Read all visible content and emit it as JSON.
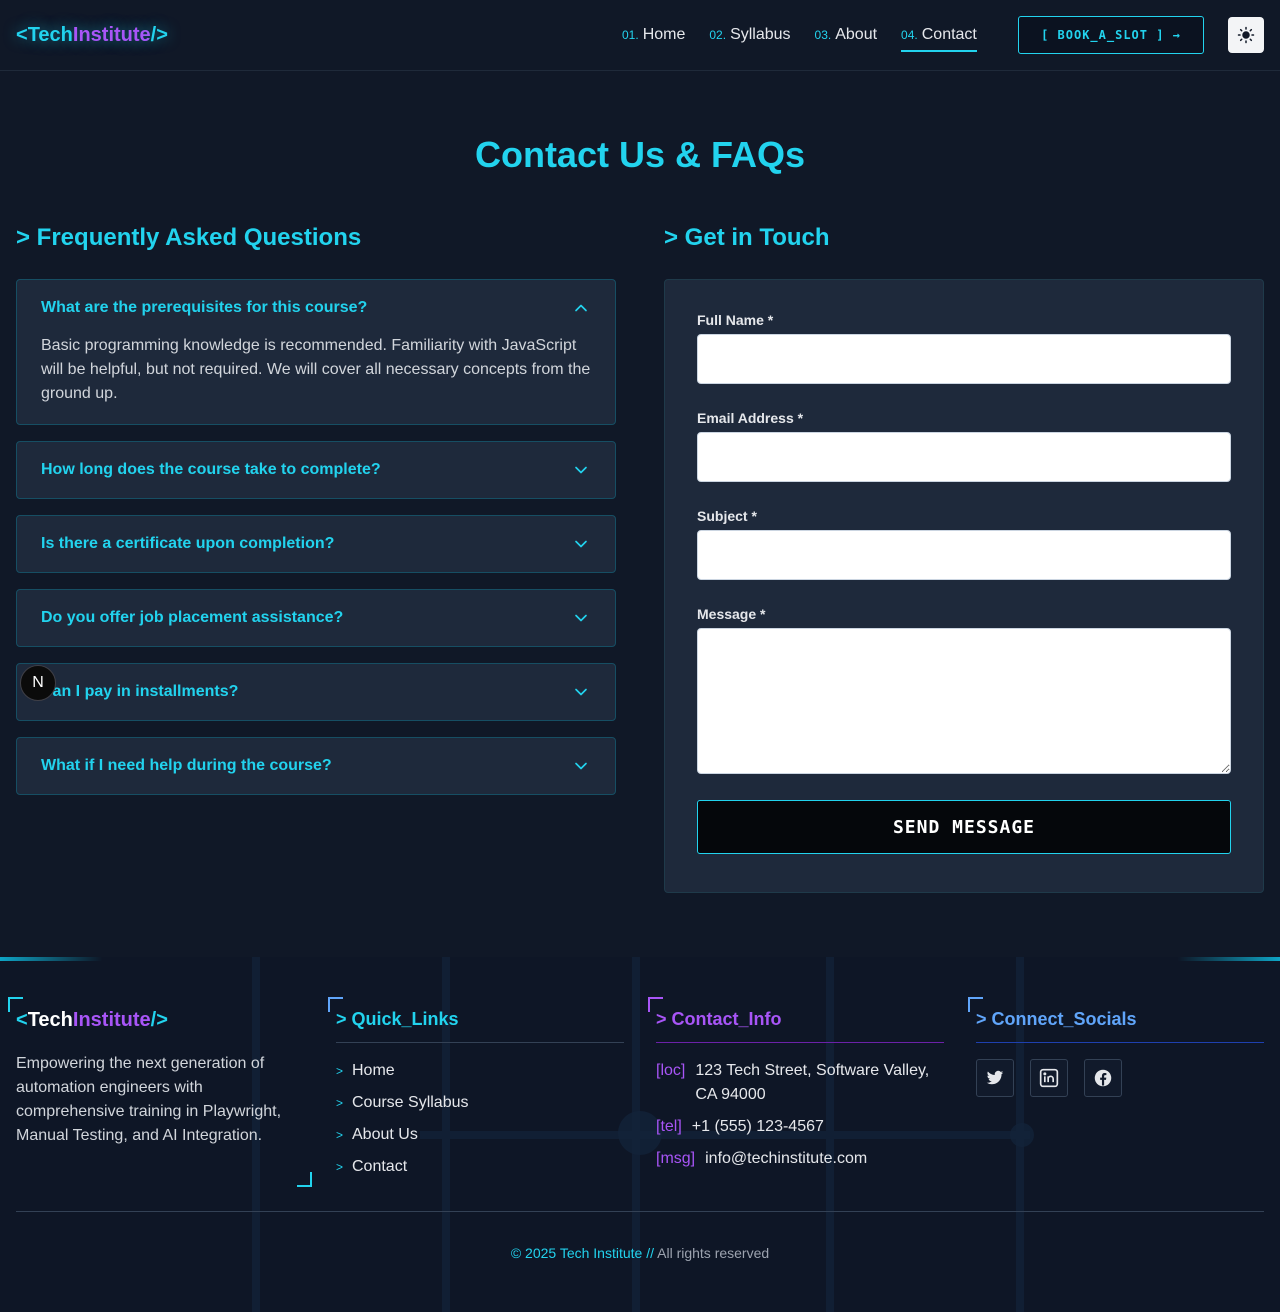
{
  "nav": {
    "logo": {
      "open": "<",
      "part1": "Tech",
      "part2": "Institute",
      "close": "/>"
    },
    "links": [
      {
        "num": "01.",
        "label": "Home"
      },
      {
        "num": "02.",
        "label": "Syllabus"
      },
      {
        "num": "03.",
        "label": "About"
      },
      {
        "num": "04.",
        "label": "Contact"
      }
    ],
    "book_label": "[ BOOK_A_SLOT ] →"
  },
  "page": {
    "title": "Contact Us & FAQs",
    "faq_title": "> Frequently Asked Questions",
    "form_title": "> Get in Touch"
  },
  "faqs": [
    {
      "q": "What are the prerequisites for this course?",
      "a": "Basic programming knowledge is recommended. Familiarity with JavaScript will be helpful, but not required. We will cover all necessary concepts from the ground up.",
      "expanded": true
    },
    {
      "q": "How long does the course take to complete?",
      "expanded": false
    },
    {
      "q": "Is there a certificate upon completion?",
      "expanded": false
    },
    {
      "q": "Do you offer job placement assistance?",
      "expanded": false
    },
    {
      "q": "Can I pay in installments?",
      "expanded": false
    },
    {
      "q": "What if I need help during the course?",
      "expanded": false
    }
  ],
  "overlay_badge": "N",
  "form": {
    "name_label": "Full Name *",
    "email_label": "Email Address *",
    "subject_label": "Subject *",
    "message_label": "Message *",
    "name_value": "",
    "email_value": "",
    "subject_value": "",
    "message_value": "",
    "submit_label": "SEND MESSAGE"
  },
  "footer": {
    "logo": {
      "open": "<",
      "part1": "Tech",
      "part2": "Institute",
      "close": "/>"
    },
    "description": "Empowering the next generation of automation engineers with comprehensive training in Playwright, Manual Testing, and AI Integration.",
    "quick_links_title": "> Quick_Links",
    "quick_links": [
      "Home",
      "Course Syllabus",
      "About Us",
      "Contact"
    ],
    "contact_title": "> Contact_Info",
    "contact": [
      {
        "key": "[loc]",
        "value": "123 Tech Street, Software Valley, CA 94000"
      },
      {
        "key": "[tel]",
        "value": "+1 (555) 123-4567"
      },
      {
        "key": "[msg]",
        "value": "info@techinstitute.com"
      }
    ],
    "socials_title": "> Connect_Socials",
    "socials": [
      "twitter-icon",
      "linkedin-icon",
      "facebook-icon"
    ],
    "copyright_prefix": "© 2025",
    "copyright_brand": "Tech Institute //",
    "copyright_suffix": "All rights reserved"
  },
  "colors": {
    "background": "#101827",
    "accent_cyan": "#22d3ee",
    "accent_purple": "#a855f7",
    "accent_blue": "#60a5fa",
    "card": "#1e293b"
  }
}
